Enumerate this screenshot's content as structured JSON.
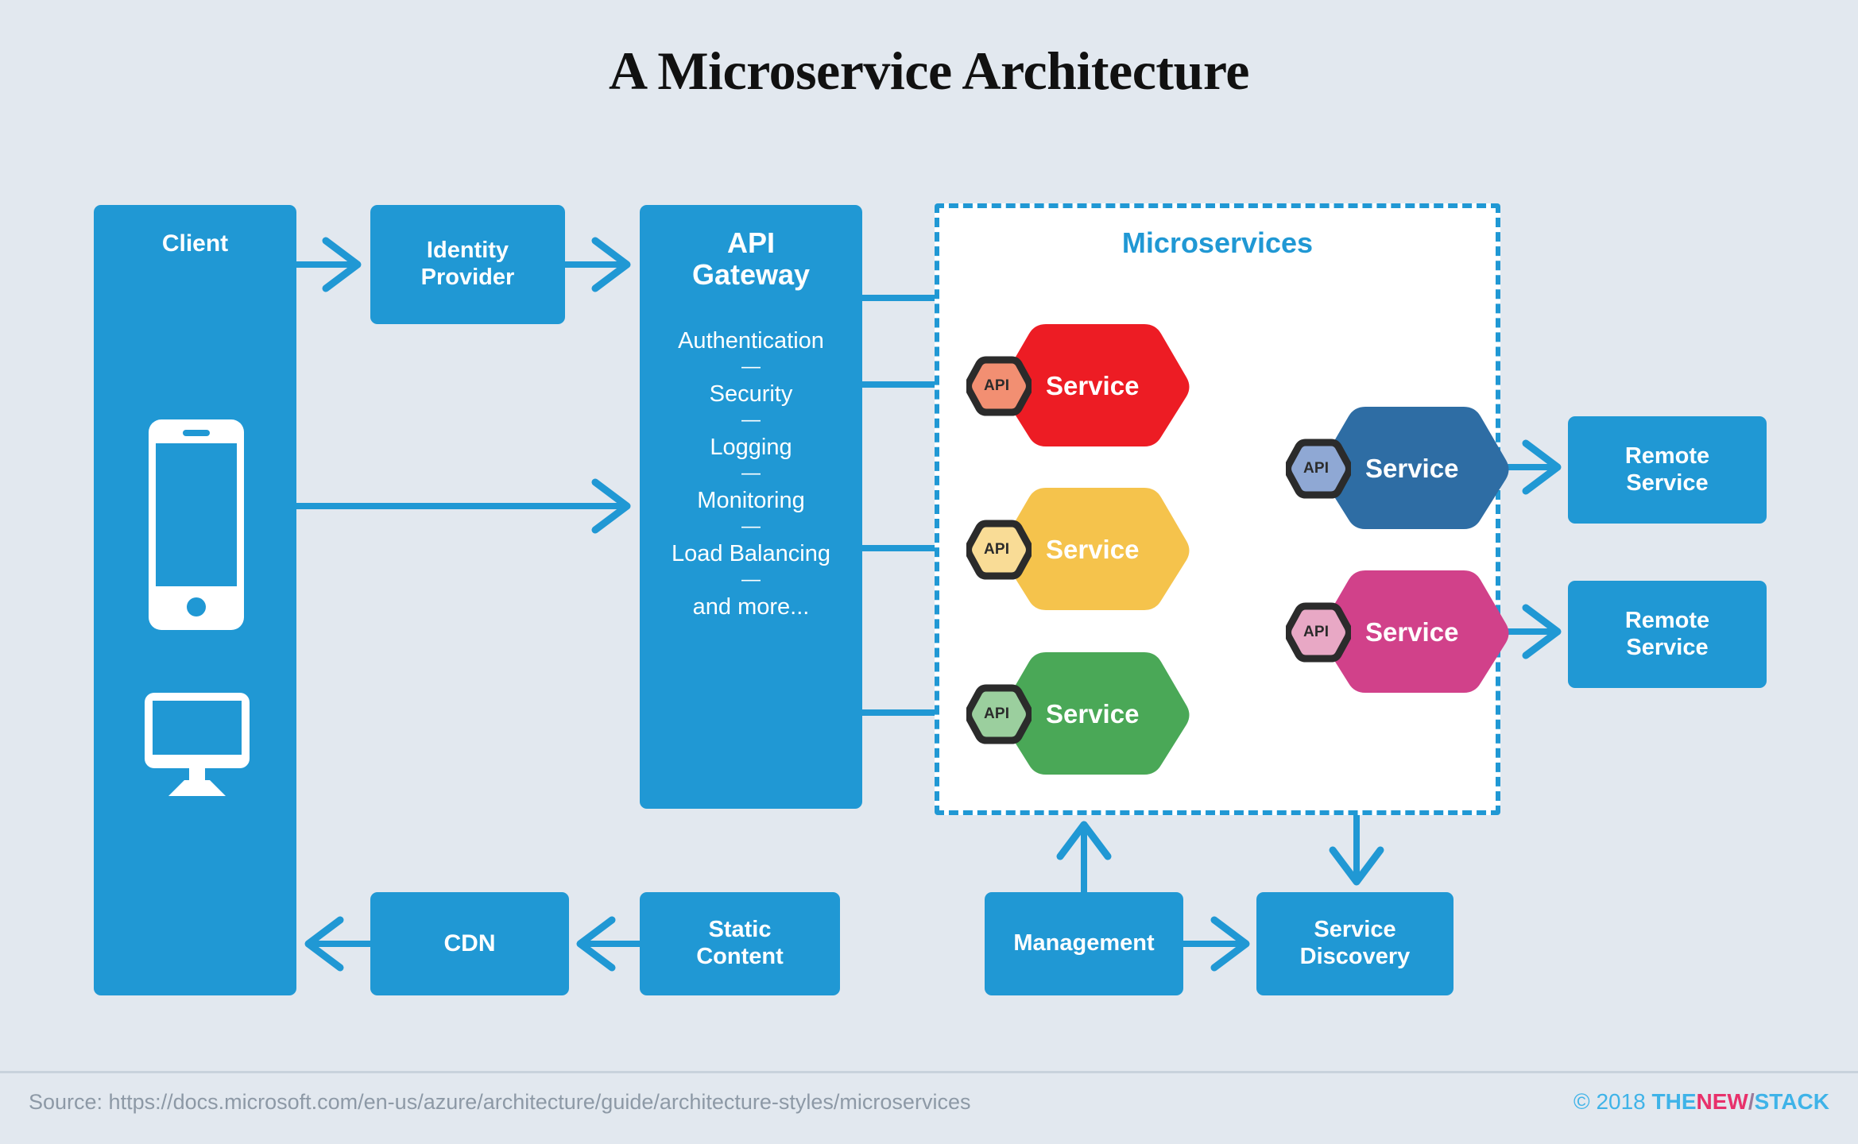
{
  "title": "A Microservice Architecture",
  "client": {
    "label": "Client",
    "icons": [
      "phone-icon",
      "monitor-icon"
    ]
  },
  "identity_provider": {
    "label": "Identity\nProvider",
    "line1": "Identity",
    "line2": "Provider"
  },
  "api_gateway": {
    "title_line1": "API",
    "title_line2": "Gateway",
    "separator": "—",
    "features": [
      "Authentication",
      "Security",
      "Logging",
      "Monitoring",
      "Load Balancing",
      "and more..."
    ]
  },
  "microservices": {
    "title": "Microservices",
    "services": [
      {
        "label": "Service",
        "badge": "API",
        "color": "#ed1c24",
        "badge_color": "#f28f72",
        "name": "service-red"
      },
      {
        "label": "Service",
        "badge": "API",
        "color": "#f5c34c",
        "badge_color": "#f9dc96",
        "name": "service-yellow"
      },
      {
        "label": "Service",
        "badge": "API",
        "color": "#4aa857",
        "badge_color": "#9bcf9e",
        "name": "service-green"
      },
      {
        "label": "Service",
        "badge": "API",
        "color": "#2e6da4",
        "badge_color": "#8fa8d4",
        "name": "service-blue"
      },
      {
        "label": "Service",
        "badge": "API",
        "color": "#d1418a",
        "badge_color": "#e8a8c5",
        "name": "service-pink"
      }
    ]
  },
  "remote_services": [
    {
      "line1": "Remote",
      "line2": "Service"
    },
    {
      "line1": "Remote",
      "line2": "Service"
    }
  ],
  "cdn": {
    "label": "CDN"
  },
  "static_content": {
    "line1": "Static",
    "line2": "Content"
  },
  "management": {
    "label": "Management"
  },
  "service_discovery": {
    "line1": "Service",
    "line2": "Discovery"
  },
  "footer": {
    "source": "Source: https://docs.microsoft.com/en-us/azure/architecture/guide/architecture-styles/microservices",
    "copyright": "© 2018",
    "brand_the": "THE",
    "brand_new": "NEW",
    "brand_slash": "/",
    "brand_stack": "STACK"
  },
  "colors": {
    "background": "#e2e8ef",
    "accent_blue": "#2098d4",
    "panel_white": "#ffffff",
    "title_black": "#111111",
    "footer_gray": "#8d99a6"
  }
}
